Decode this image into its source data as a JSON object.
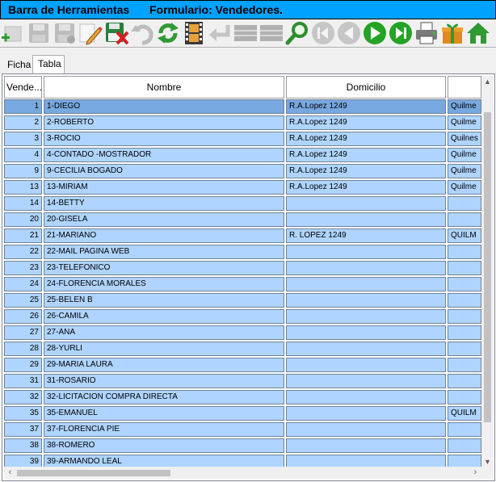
{
  "title_bar": {
    "left_text": "Barra de Herramientas",
    "right_text": "Formulario: Vendedores."
  },
  "toolbar": {
    "buttons": [
      {
        "icon": "add-icon"
      },
      {
        "icon": "save-icon"
      },
      {
        "icon": "save-as-icon"
      },
      {
        "icon": "edit-pencil-icon"
      },
      {
        "icon": "cancel-edit-icon"
      },
      {
        "icon": "undo-icon"
      },
      {
        "icon": "refresh-icon"
      },
      {
        "icon": "filmstrip-icon"
      },
      {
        "icon": "return-arrow-icon"
      },
      {
        "icon": "table-icon"
      },
      {
        "icon": "table-alt-icon"
      },
      {
        "icon": "search-icon"
      },
      {
        "icon": "first-record-icon"
      },
      {
        "icon": "previous-record-icon"
      },
      {
        "icon": "next-record-icon"
      },
      {
        "icon": "last-record-icon"
      },
      {
        "icon": "printer-icon"
      },
      {
        "icon": "gift-icon"
      },
      {
        "icon": "home-icon"
      }
    ]
  },
  "tabs": [
    {
      "label": "Ficha",
      "active": false
    },
    {
      "label": "Tabla",
      "active": true
    }
  ],
  "grid": {
    "columns": [
      "Vende...",
      "Nombre",
      "Domicilio",
      ""
    ],
    "rows": [
      {
        "id": "1",
        "nombre": "1-DIEGO",
        "domicilio": "R.A.Lopez 1249",
        "extra": "Quilme",
        "selected": true
      },
      {
        "id": "2",
        "nombre": "2-ROBERTO",
        "domicilio": "R.A.Lopez 1249",
        "extra": "Quilme"
      },
      {
        "id": "3",
        "nombre": "3-ROCIO",
        "domicilio": "R.A.Lopez 1249",
        "extra": "Quilnes"
      },
      {
        "id": "4",
        "nombre": "4-CONTADO -MOSTRADOR",
        "domicilio": "R.A.Lopez 1249",
        "extra": "Quilme"
      },
      {
        "id": "9",
        "nombre": "9-CECILIA BOGADO",
        "domicilio": "R.A.Lopez 1249",
        "extra": "Quilme"
      },
      {
        "id": "13",
        "nombre": "13-MIRIAM",
        "domicilio": "R.A.Lopez 1249",
        "extra": "Quilme"
      },
      {
        "id": "14",
        "nombre": "14-BETTY",
        "domicilio": "",
        "extra": ""
      },
      {
        "id": "20",
        "nombre": "20-GISELA",
        "domicilio": "",
        "extra": ""
      },
      {
        "id": "21",
        "nombre": "21-MARIANO",
        "domicilio": "R. LOPEZ 1249",
        "extra": "QUILM"
      },
      {
        "id": "22",
        "nombre": "22-MAIL PAGINA WEB",
        "domicilio": "",
        "extra": ""
      },
      {
        "id": "23",
        "nombre": "23-TELEFONICO",
        "domicilio": "",
        "extra": ""
      },
      {
        "id": "24",
        "nombre": "24-FLORENCIA MORALES",
        "domicilio": "",
        "extra": ""
      },
      {
        "id": "25",
        "nombre": "25-BELEN B",
        "domicilio": "",
        "extra": ""
      },
      {
        "id": "26",
        "nombre": "26-CAMILA",
        "domicilio": "",
        "extra": ""
      },
      {
        "id": "27",
        "nombre": "27-ANA",
        "domicilio": "",
        "extra": ""
      },
      {
        "id": "28",
        "nombre": "28-YURLI",
        "domicilio": "",
        "extra": ""
      },
      {
        "id": "29",
        "nombre": "29-MARIA LAURA",
        "domicilio": "",
        "extra": ""
      },
      {
        "id": "31",
        "nombre": "31-ROSARIO",
        "domicilio": "",
        "extra": ""
      },
      {
        "id": "32",
        "nombre": "32-LICITACION COMPRA DIRECTA",
        "domicilio": "",
        "extra": ""
      },
      {
        "id": "35",
        "nombre": "35-EMANUEL",
        "domicilio": "",
        "extra": "QUILM"
      },
      {
        "id": "37",
        "nombre": "37-FLORENCIA PIE",
        "domicilio": "",
        "extra": ""
      },
      {
        "id": "38",
        "nombre": "38-ROMERO",
        "domicilio": "",
        "extra": ""
      },
      {
        "id": "39",
        "nombre": "39-ARMANDO LEAL",
        "domicilio": "",
        "extra": ""
      }
    ]
  },
  "colors": {
    "title_bar": "#00a2ff",
    "row": "#aed4ff",
    "row_selected": "#78a8e0"
  }
}
